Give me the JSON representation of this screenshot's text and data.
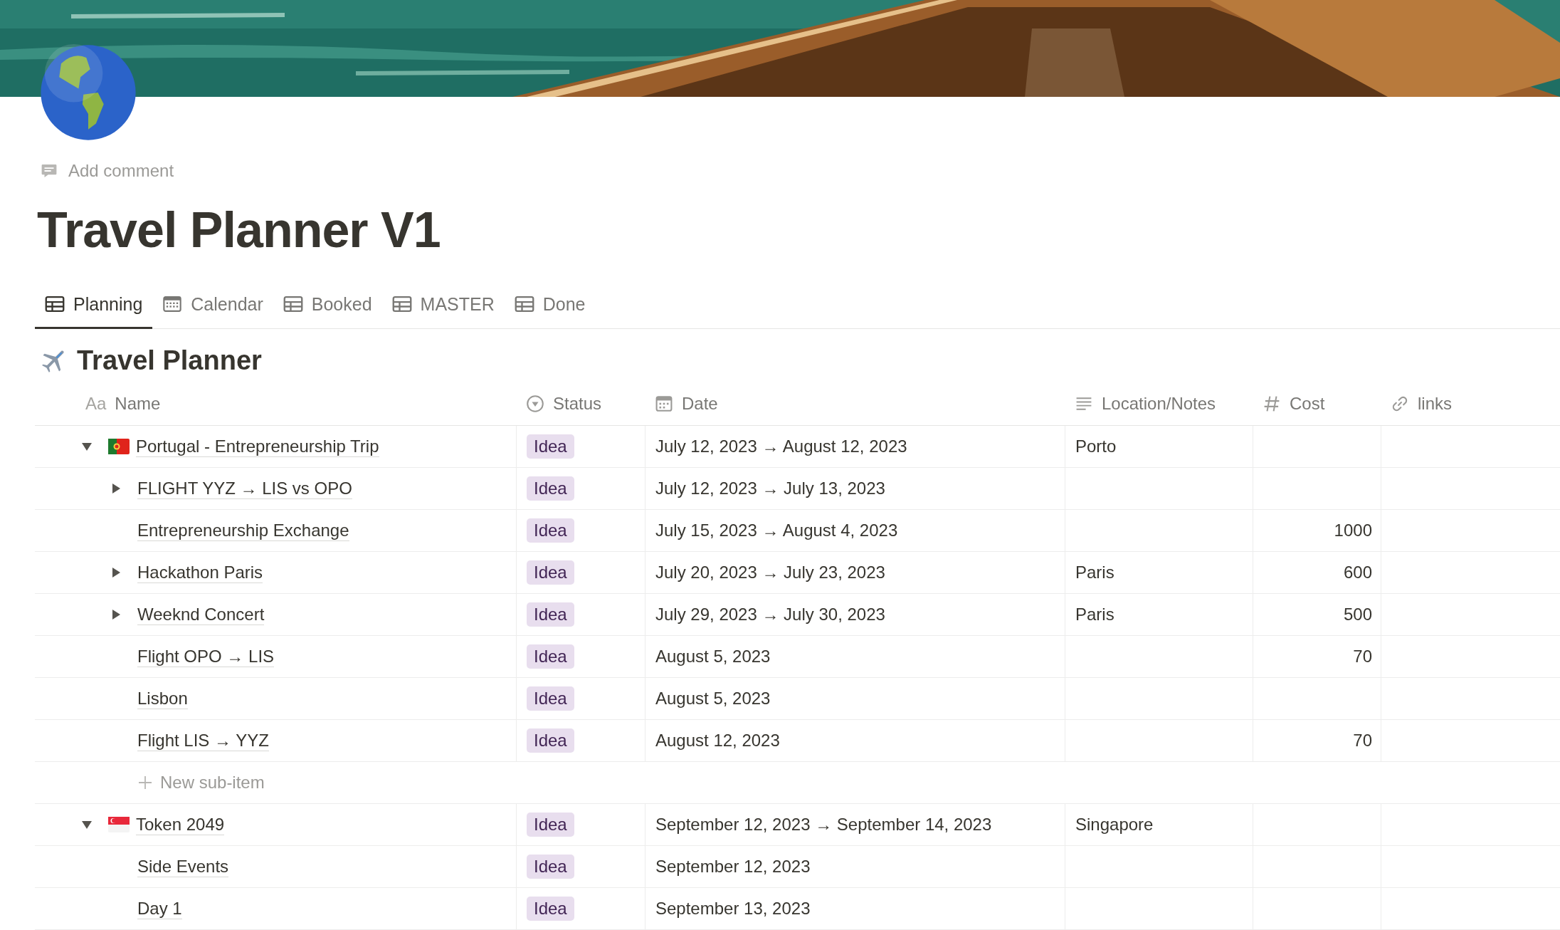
{
  "add_comment": "Add comment",
  "title": "Travel Planner V1",
  "tabs": [
    {
      "label": "Planning",
      "kind": "table",
      "selected": true
    },
    {
      "label": "Calendar",
      "kind": "calendar",
      "selected": false
    },
    {
      "label": "Booked",
      "kind": "table",
      "selected": false
    },
    {
      "label": "MASTER",
      "kind": "table",
      "selected": false
    },
    {
      "label": "Done",
      "kind": "table",
      "selected": false
    }
  ],
  "database_title": "Travel Planner",
  "table": {
    "columns": [
      {
        "label": "Name",
        "kind": "title",
        "glyph": "Aa"
      },
      {
        "label": "Status",
        "kind": "status"
      },
      {
        "label": "Date",
        "kind": "date"
      },
      {
        "label": "Location/Notes",
        "kind": "text"
      },
      {
        "label": "Cost",
        "kind": "number"
      },
      {
        "label": "links",
        "kind": "url"
      }
    ],
    "rows": [
      {
        "name": "Portugal - Entrepreneurship Trip",
        "kind": "pt",
        "expanded": true,
        "status": "Idea",
        "date": "July 12, 2023 → August 12, 2023",
        "location": "Porto",
        "new_sub_item": "New sub-item",
        "children": [
          {
            "name": "FLIGHT YYZ → LIS vs OPO",
            "expanded": false,
            "status": "Idea",
            "date": "July 12, 2023 → July 13, 2023"
          },
          {
            "name": "Entrepreneurship Exchange",
            "status": "Idea",
            "date": "July 15, 2023 → August 4, 2023",
            "cost": "1000"
          },
          {
            "name": "Hackathon Paris",
            "expanded": false,
            "status": "Idea",
            "date": "July 20, 2023 → July 23, 2023",
            "location": "Paris",
            "cost": "600"
          },
          {
            "name": "Weeknd Concert",
            "expanded": false,
            "status": "Idea",
            "date": "July 29, 2023 → July 30, 2023",
            "location": "Paris",
            "cost": "500"
          },
          {
            "name": "Flight OPO → LIS",
            "status": "Idea",
            "date": "August 5, 2023",
            "cost": "70"
          },
          {
            "name": "Lisbon",
            "status": "Idea",
            "date": "August 5, 2023"
          },
          {
            "name": "Flight LIS → YYZ",
            "status": "Idea",
            "date": "August 12, 2023",
            "cost": "70"
          }
        ]
      },
      {
        "name": "Token 2049",
        "kind": "sg",
        "expanded": true,
        "status": "Idea",
        "date": "September 12, 2023 → September 14, 2023",
        "location": "Singapore",
        "children": [
          {
            "name": "Side Events",
            "status": "Idea",
            "date": "September 12, 2023"
          },
          {
            "name": "Day 1",
            "status": "Idea",
            "date": "September 13, 2023"
          }
        ]
      }
    ]
  }
}
